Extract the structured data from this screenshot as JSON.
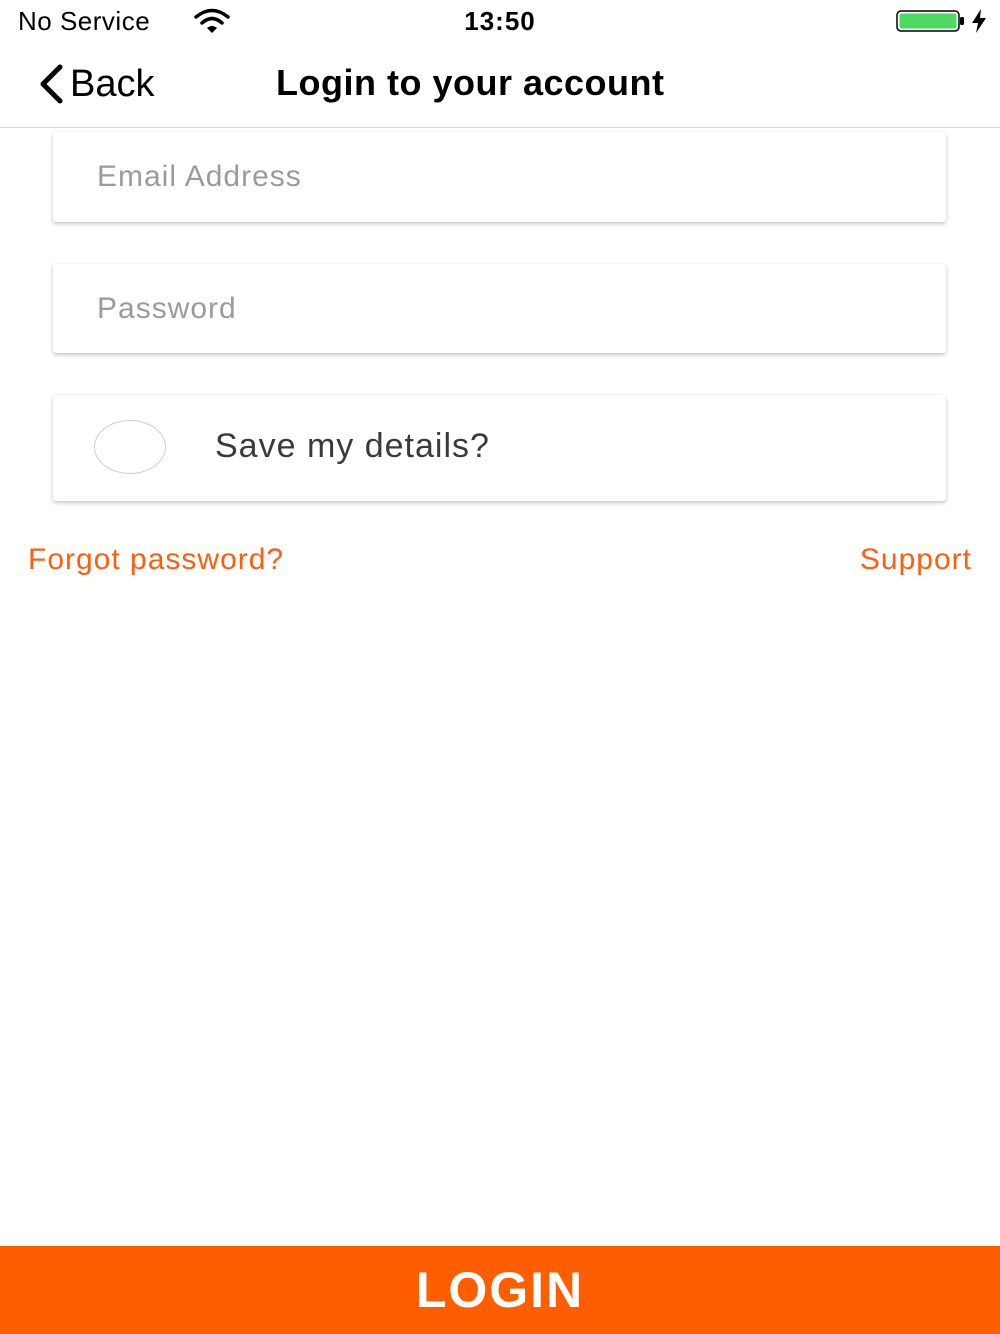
{
  "status_bar": {
    "carrier": "No Service",
    "time": "13:50",
    "wifi_icon": "wifi-icon",
    "battery_icon": "battery-icon",
    "battery_level": 1.0,
    "battery_color": "#4cd964",
    "charging_icon": "lightning-bolt-icon"
  },
  "nav": {
    "back_label": "Back",
    "back_icon": "chevron-left-icon",
    "title": "Login to your account"
  },
  "form": {
    "email_placeholder": "Email Address",
    "email_value": "",
    "password_placeholder": "Password",
    "password_value": "",
    "save_details_label": "Save my details?",
    "save_details_checked": false
  },
  "links": {
    "forgot_password": "Forgot password?",
    "support": "Support"
  },
  "login_button": {
    "label": "LOGIN"
  },
  "colors": {
    "accent": "#ff5e00",
    "link": "#ff5e0e",
    "background": "#ffffff"
  }
}
